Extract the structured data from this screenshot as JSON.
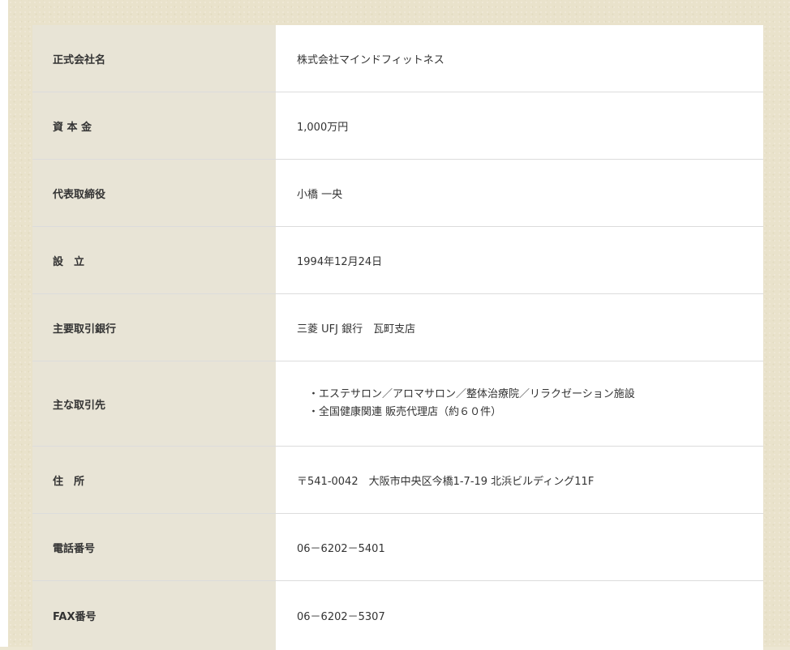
{
  "company_table": {
    "rows": [
      {
        "label": "正式会社名",
        "value": "株式会社マインドフィットネス"
      },
      {
        "label": "資 本 金",
        "value": "1,000万円"
      },
      {
        "label": "代表取締役",
        "value": "小橋 一央"
      },
      {
        "label": "設　立",
        "value": "1994年12月24日"
      },
      {
        "label": "主要取引銀行",
        "value": "三菱 UFJ 銀行　瓦町支店"
      },
      {
        "label": "主な取引先",
        "lines": [
          "・エステサロン／アロマサロン／整体治療院／リラクゼーション施設",
          "・全国健康関連 販売代理店（約６０件）"
        ]
      },
      {
        "label": "住　所",
        "value": "〒541-0042　大阪市中央区今橋1-7-19 北浜ビルディング11F"
      },
      {
        "label": "電話番号",
        "value": "06－6202－5401"
      },
      {
        "label": "FAX番号",
        "value": "06－6202－5307"
      }
    ]
  }
}
